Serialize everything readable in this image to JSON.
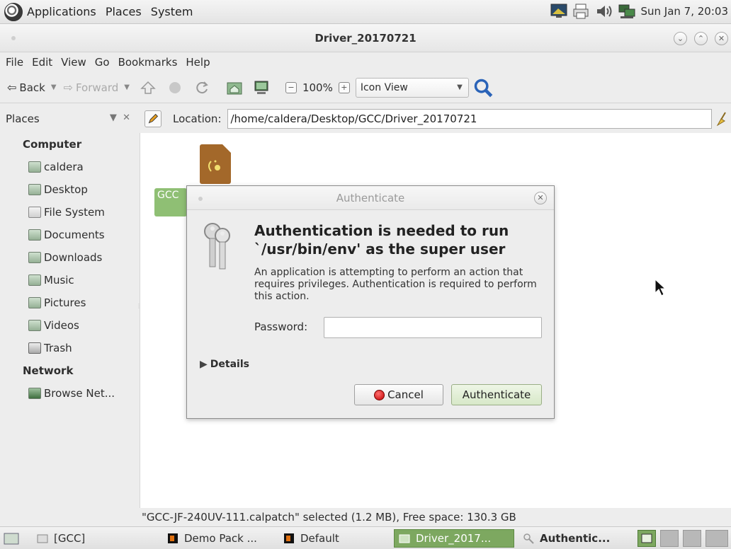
{
  "panel": {
    "menus": [
      "Applications",
      "Places",
      "System"
    ],
    "clock": "Sun Jan  7, 20:03"
  },
  "window": {
    "title": "Driver_20170721"
  },
  "menubar": [
    "File",
    "Edit",
    "View",
    "Go",
    "Bookmarks",
    "Help"
  ],
  "toolbar": {
    "back": "Back",
    "forward": "Forward",
    "zoom": "100%",
    "view_mode": "Icon View"
  },
  "places": {
    "title": "Places",
    "computer_heading": "Computer",
    "computer_items": [
      "caldera",
      "Desktop",
      "File System",
      "Documents",
      "Downloads",
      "Music",
      "Pictures",
      "Videos",
      "Trash"
    ],
    "network_heading": "Network",
    "network_items": [
      "Browse Net..."
    ]
  },
  "location": {
    "label": "Location:",
    "path": "/home/caldera/Desktop/GCC/Driver_20170721"
  },
  "content": {
    "file_label": "GCC"
  },
  "statusbar": "\"GCC-JF-240UV-111.calpatch\" selected (1.2 MB), Free space: 130.3 GB",
  "dialog": {
    "title": "Authenticate",
    "heading": "Authentication is needed to run `/usr/bin/env' as the super user",
    "body": "An application is attempting to perform an action that requires privileges. Authentication is required to perform this action.",
    "password_label": "Password:",
    "password_value": "",
    "details": "Details",
    "cancel": "Cancel",
    "authenticate": "Authenticate"
  },
  "taskbar": {
    "items": [
      "[GCC]",
      "Demo Pack ...",
      "Default",
      "Driver_2017...",
      "Authentic..."
    ]
  },
  "colors": {
    "accent_green": "#7da860",
    "auth_button": "#d7e8c8",
    "cancel_icon": "#c40000"
  }
}
